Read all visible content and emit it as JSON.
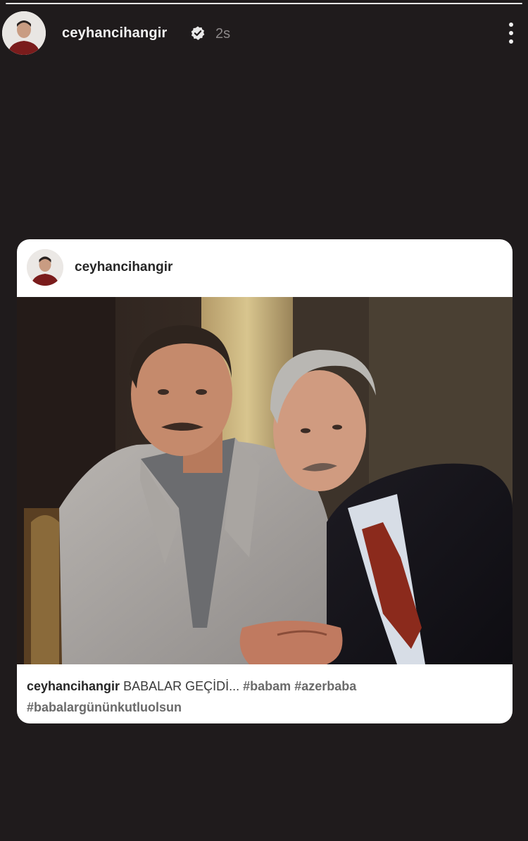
{
  "story": {
    "progress": 1.0,
    "username": "ceyhancihangir",
    "verified": true,
    "time_ago": "2s",
    "more_icon": "more-vertical-icon"
  },
  "shared_post": {
    "username": "ceyhancihangir",
    "caption_user": "ceyhancihangir",
    "caption_text": "BABALAR GEÇİDİ...",
    "hashtags": [
      "#babam",
      "#azerbaba",
      "#babalargününkutluolsun"
    ]
  },
  "colors": {
    "background": "#1f1b1c",
    "card": "#ffffff",
    "username_top": "#f2f2f2",
    "muted": "#8c8889"
  }
}
